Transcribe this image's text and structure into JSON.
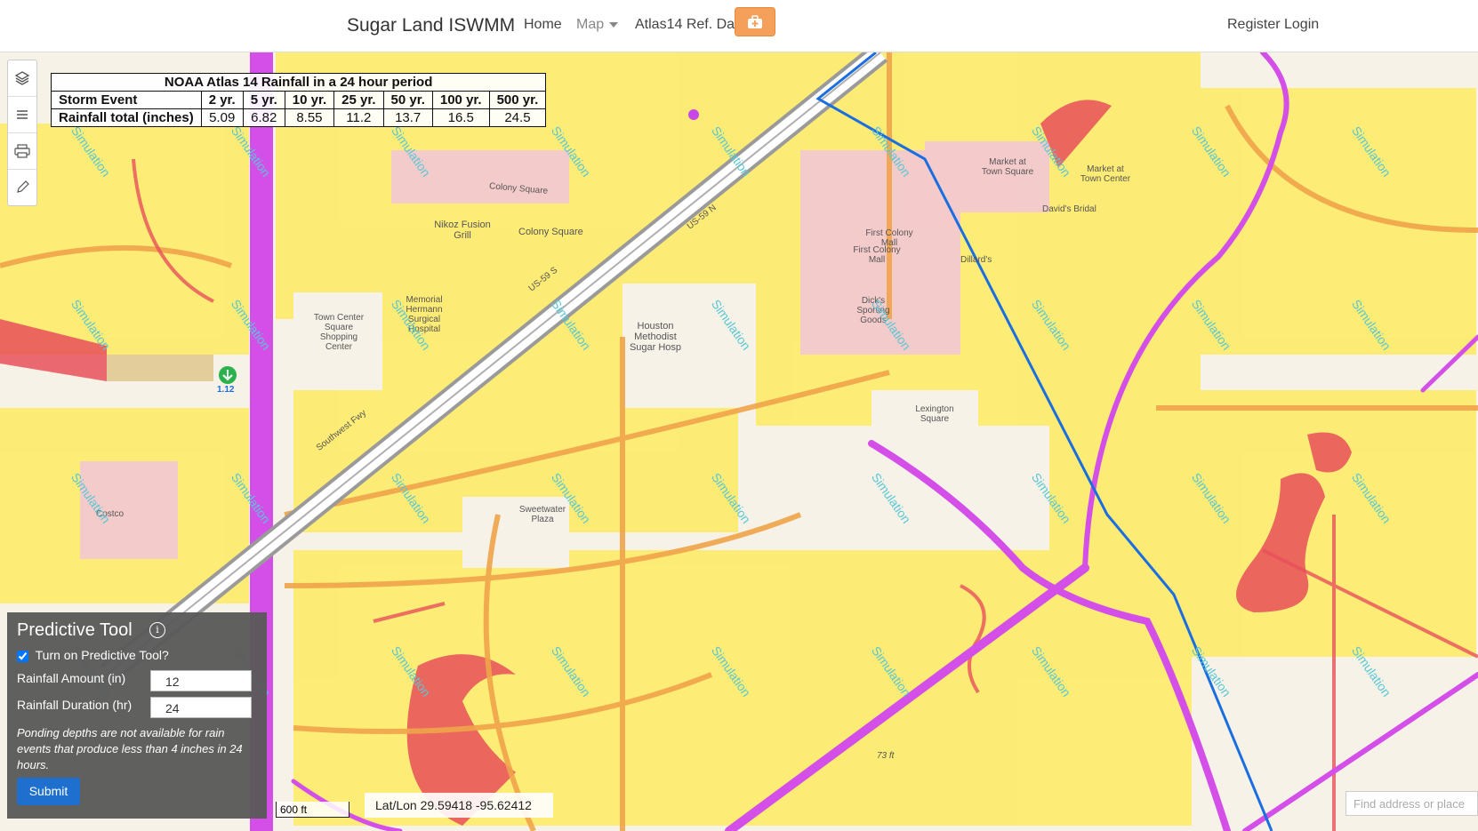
{
  "navbar": {
    "brand": "Sugar Land ISWMM",
    "links": [
      "Home",
      "Map",
      "Atlas14 Ref. Data"
    ],
    "right_links": [
      "Register",
      "Login"
    ],
    "tool_icon": "briefcase-medical-icon"
  },
  "toolbar": {
    "icons": [
      "layers-icon",
      "list-icon",
      "print-icon",
      "pencil-icon"
    ]
  },
  "rainfall_table": {
    "title": "NOAA Atlas 14 Rainfall in a 24 hour period",
    "row1_label": "Storm Event",
    "row2_label": "Rainfall total (inches)",
    "events": [
      "2 yr.",
      "5 yr.",
      "10 yr.",
      "25 yr.",
      "50 yr.",
      "100 yr.",
      "500 yr."
    ],
    "totals": [
      "5.09",
      "6.82",
      "8.55",
      "11.2",
      "13.7",
      "16.5",
      "24.5"
    ]
  },
  "predictive_tool": {
    "title": "Predictive Tool",
    "checkbox_label": "Turn on Predictive Tool?",
    "checked": true,
    "amount_label": "Rainfall Amount (in)",
    "amount_value": "12",
    "duration_label": "Rainfall Duration (hr)",
    "duration_value": "24",
    "note": "Ponding depths are not available for rain events that produce less than 4 inches in 24 hours.",
    "submit_label": "Submit"
  },
  "map": {
    "scale_label": "600 ft",
    "latlon": "Lat/Lon 29.59418 -95.62412",
    "search_placeholder": "Find address or place",
    "gauge_value": "1.12",
    "watermark": "Simulation",
    "place_labels": {
      "colony_square_road": "Colony Square",
      "nikoz": "Nikoz Fusion Grill",
      "colony_square": "Colony Square",
      "memorial": "Memorial Hermann Surgical Hospital",
      "town_center": "Town Center Square Shopping Center",
      "houston_methodist": "Houston Methodist Sugar Hosp",
      "first_colony": "First Colony Mall",
      "first_colony_mall": "First Colony Mall",
      "dillards": "Dillard's",
      "dicks": "Dick's Sporting Goods",
      "market_town": "Market at Town Square",
      "market_center": "Market at Town Center",
      "davids": "David's Bridal",
      "lexington": "Lexington Square",
      "sweetwater": "Sweetwater Plaza",
      "costco": "Costco",
      "southwest_fwy": "Southwest Fwy",
      "us59n": "US-59 N",
      "us59s": "US-59 S",
      "elev": "73 ft"
    }
  }
}
